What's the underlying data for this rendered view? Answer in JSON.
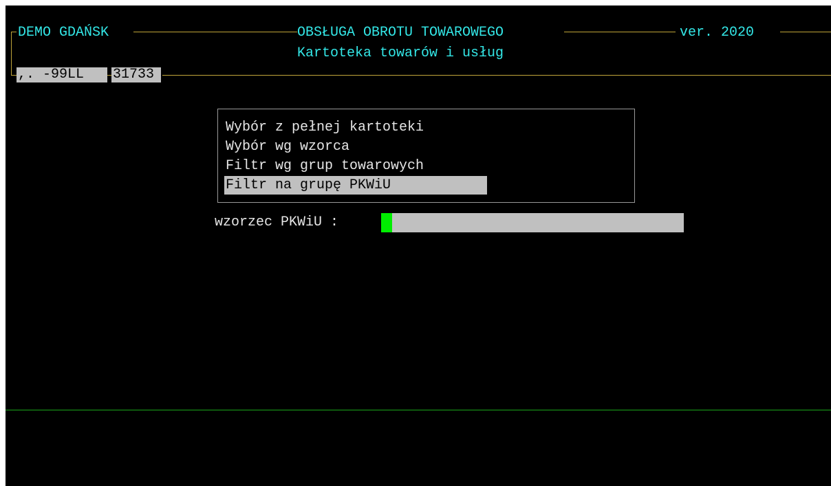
{
  "header": {
    "company": "DEMO GDAŃSK",
    "module_title": "OBSŁUGA OBROTU TOWAROWEGO",
    "version": "ver. 2020",
    "subtitle": "Kartoteka towarów i usług",
    "status_left": ",. -99LL",
    "status_right": "31733"
  },
  "menu": {
    "items": [
      {
        "label": "Wybór z pełnej kartoteki",
        "selected": false
      },
      {
        "label": "Wybór wg wzorca",
        "selected": false
      },
      {
        "label": "Filtr wg grup towarowych",
        "selected": false
      },
      {
        "label": "Filtr na grupę PKWiU",
        "selected": true
      }
    ]
  },
  "pattern_input": {
    "label": "wzorzec PKWiU :",
    "value": ""
  },
  "colors": {
    "background": "#000000",
    "header_text": "#33e6e6",
    "frame": "#c2a63a",
    "highlight": "#c0c0c0",
    "cursor": "#00ee00",
    "status_line": "#1aa81a"
  }
}
